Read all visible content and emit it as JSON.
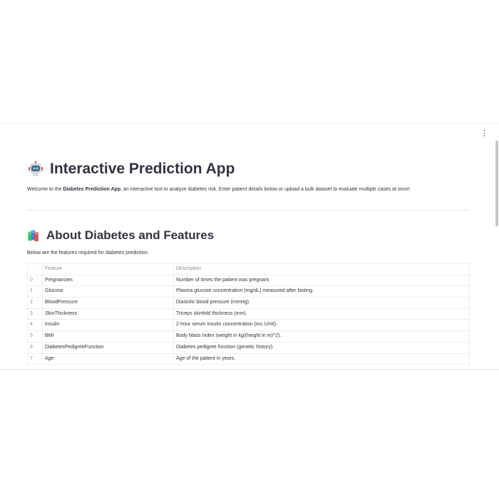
{
  "app": {
    "menu_icon_glyph": "⋮",
    "title": "Interactive Prediction App",
    "intro": {
      "prefix": "Welcome to the ",
      "app_name": "Diabetes Prediction App",
      "suffix": ", an interactive tool to analyze diabetes risk. Enter patient details below or upload a bulk dataset to evaluate multiple cases at once!"
    },
    "features_section": {
      "title": "About Diabetes and Features",
      "subtitle": "Below are the features required for diabetes prediction:",
      "columns": [
        "",
        "Feature",
        "Description"
      ],
      "rows": [
        {
          "index": "0",
          "feature": "Pregnancies",
          "description": "Number of times the patient was pregnant."
        },
        {
          "index": "1",
          "feature": "Glucose",
          "description": "Plasma glucose concentration (mg/dL) measured after fasting."
        },
        {
          "index": "2",
          "feature": "BloodPressure",
          "description": "Diastolic blood pressure (mmHg)."
        },
        {
          "index": "3",
          "feature": "SkinThickness",
          "description": "Triceps skinfold thickness (mm)."
        },
        {
          "index": "4",
          "feature": "Insulin",
          "description": "2-hour serum insulin concentration (mu U/ml)."
        },
        {
          "index": "5",
          "feature": "BMI",
          "description": "Body Mass Index (weight in kg/(height in m)^2)."
        },
        {
          "index": "6",
          "feature": "DiabetesPedigreeFunction",
          "description": "Diabetes pedigree function (genetic history)."
        },
        {
          "index": "7",
          "feature": "Age",
          "description": "Age of the patient in years."
        }
      ]
    }
  },
  "icons": {
    "title_icon": "robot-icon",
    "section_icon": "books-icon",
    "menu_icon": "kebab-menu-icon"
  },
  "colors": {
    "text": "#31333f",
    "muted_text": "#8a8d97",
    "border": "#eeeeee",
    "background": "#ffffff"
  }
}
